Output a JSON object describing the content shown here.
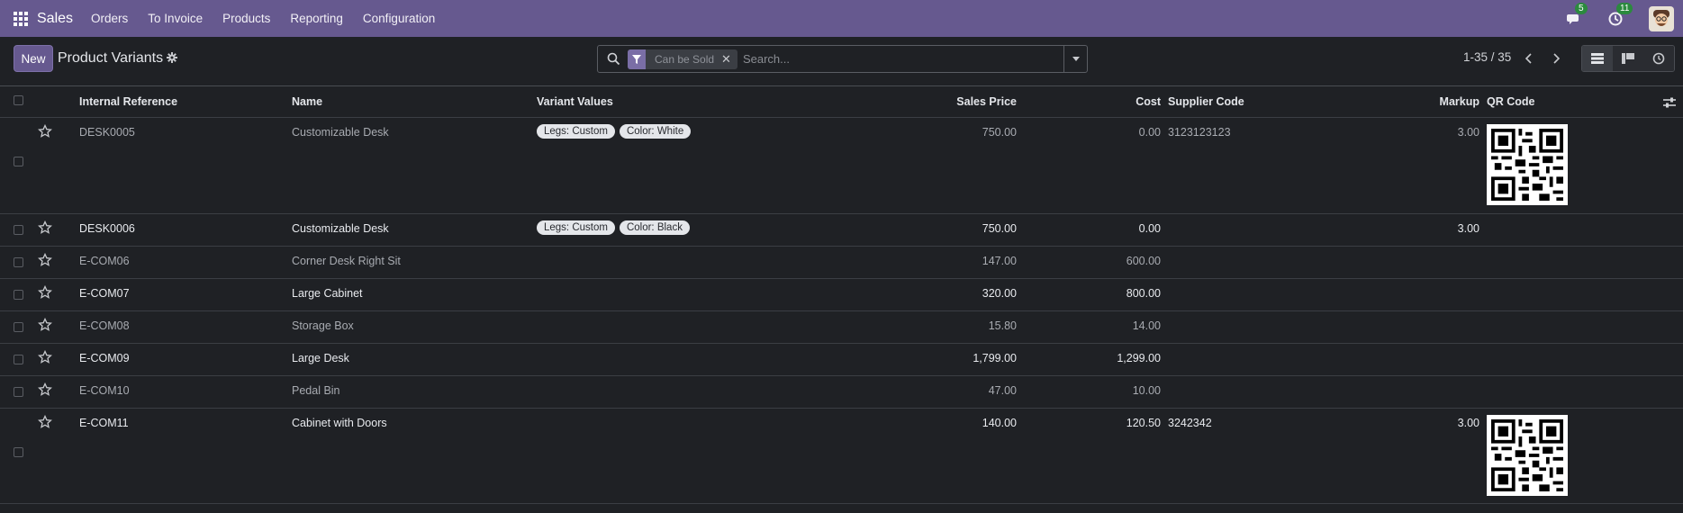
{
  "app": {
    "name": "Sales",
    "menu": [
      "Orders",
      "To Invoice",
      "Products",
      "Reporting",
      "Configuration"
    ],
    "messages_count": "5",
    "activities_count": "11"
  },
  "control": {
    "new_label": "New",
    "title": "Product Variants",
    "facet_label": "Can be Sold",
    "search_placeholder": "Search...",
    "pager": "1-35 / 35"
  },
  "table": {
    "headers": {
      "internal_ref": "Internal Reference",
      "name": "Name",
      "variant_values": "Variant Values",
      "sales_price": "Sales Price",
      "cost": "Cost",
      "supplier_code": "Supplier Code",
      "markup": "Markup",
      "qr_code": "QR Code"
    },
    "rows": [
      {
        "ref": "DESK0005",
        "name": "Customizable Desk",
        "tags": [
          "Legs: Custom",
          "Color: White"
        ],
        "price": "750.00",
        "cost": "0.00",
        "supplier": "3123123123",
        "markup": "3.00",
        "qr": true
      },
      {
        "ref": "DESK0006",
        "name": "Customizable Desk",
        "tags": [
          "Legs: Custom",
          "Color: Black"
        ],
        "price": "750.00",
        "cost": "0.00",
        "supplier": "",
        "markup": "3.00",
        "qr": false
      },
      {
        "ref": "E-COM06",
        "name": "Corner Desk Right Sit",
        "tags": [],
        "price": "147.00",
        "cost": "600.00",
        "supplier": "",
        "markup": "",
        "qr": false
      },
      {
        "ref": "E-COM07",
        "name": "Large Cabinet",
        "tags": [],
        "price": "320.00",
        "cost": "800.00",
        "supplier": "",
        "markup": "",
        "qr": false
      },
      {
        "ref": "E-COM08",
        "name": "Storage Box",
        "tags": [],
        "price": "15.80",
        "cost": "14.00",
        "supplier": "",
        "markup": "",
        "qr": false
      },
      {
        "ref": "E-COM09",
        "name": "Large Desk",
        "tags": [],
        "price": "1,799.00",
        "cost": "1,299.00",
        "supplier": "",
        "markup": "",
        "qr": false
      },
      {
        "ref": "E-COM10",
        "name": "Pedal Bin",
        "tags": [],
        "price": "47.00",
        "cost": "10.00",
        "supplier": "",
        "markup": "",
        "qr": false
      },
      {
        "ref": "E-COM11",
        "name": "Cabinet with Doors",
        "tags": [],
        "price": "140.00",
        "cost": "120.50",
        "supplier": "3242342",
        "markup": "3.00",
        "qr": true
      }
    ]
  },
  "colors": {
    "navbar": "#66598f",
    "background": "#1f2125",
    "badge": "#2b8a3e"
  }
}
